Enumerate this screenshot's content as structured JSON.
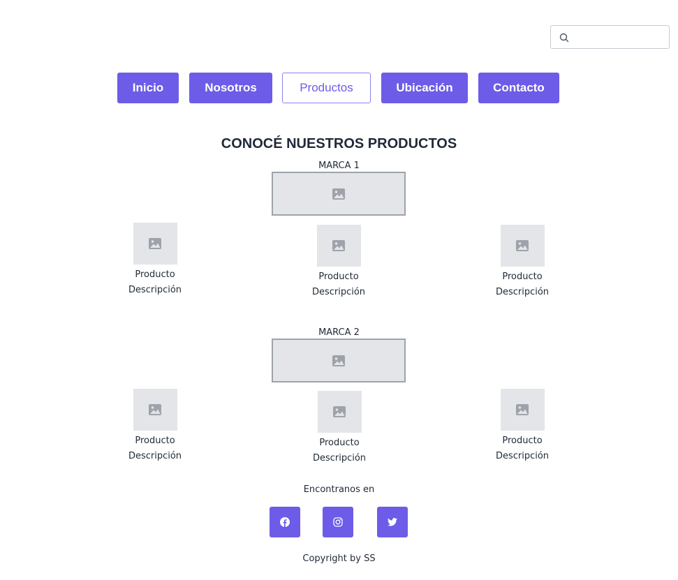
{
  "search": {
    "placeholder": "",
    "value": "",
    "icon": "search-icon"
  },
  "nav": {
    "items": [
      {
        "label": "Inicio",
        "active": false
      },
      {
        "label": "Nosotros",
        "active": false
      },
      {
        "label": "Productos",
        "active": true
      },
      {
        "label": "Ubicación",
        "active": false
      },
      {
        "label": "Contacto",
        "active": false
      }
    ]
  },
  "main": {
    "title": "CONOCÉ NUESTROS PRODUCTOS",
    "brands": [
      {
        "label": "MARCA 1",
        "products": [
          {
            "name": "Producto",
            "description": "Descripción"
          },
          {
            "name": "Producto",
            "description": "Descripción"
          },
          {
            "name": "Producto",
            "description": "Descripción"
          }
        ]
      },
      {
        "label": "MARCA 2",
        "products": [
          {
            "name": "Producto",
            "description": "Descripción"
          },
          {
            "name": "Producto",
            "description": "Descripción"
          },
          {
            "name": "Producto",
            "description": "Descripción"
          }
        ]
      }
    ]
  },
  "footer": {
    "find_us": "Encontranos en",
    "social": [
      "facebook-icon",
      "instagram-icon",
      "twitter-icon"
    ],
    "copyright": "Copyright by SS"
  },
  "colors": {
    "accent": "#6c5ce7",
    "placeholder_bg": "#e3e5e8",
    "placeholder_icon": "#9ea3ab",
    "text": "#1f2937"
  }
}
